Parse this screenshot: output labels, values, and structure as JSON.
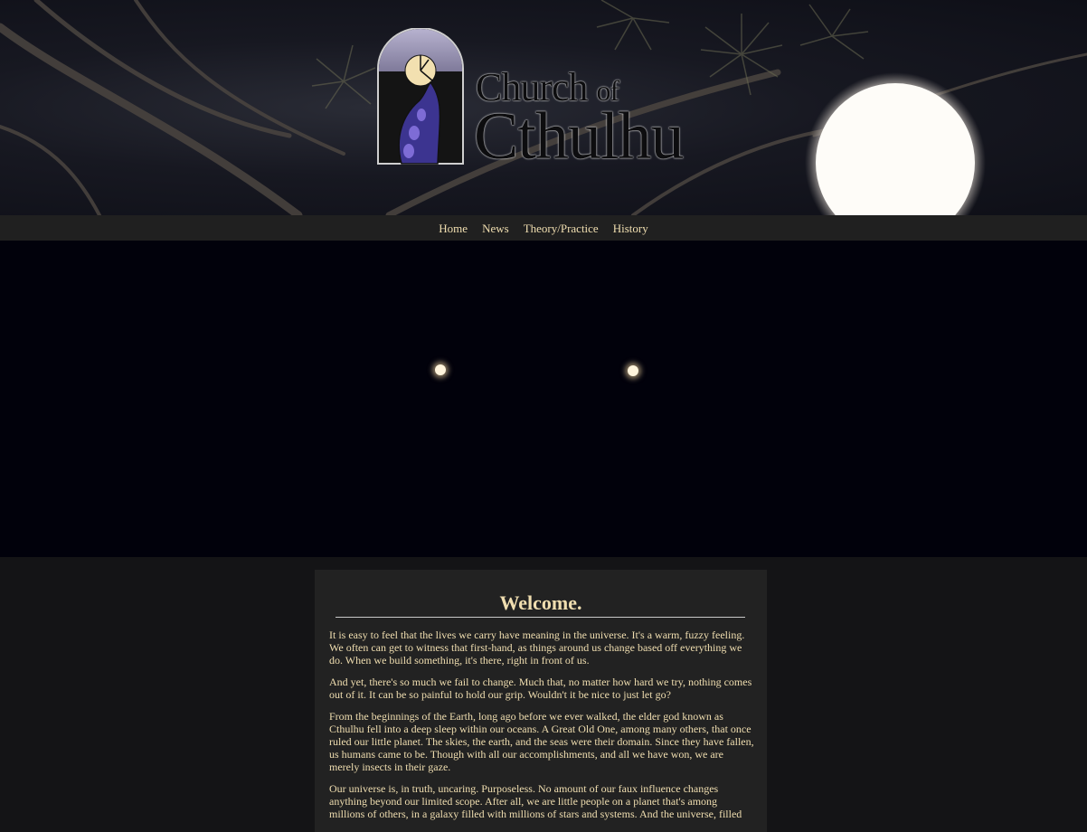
{
  "brand": {
    "line1_main": "Church",
    "line1_small": "of",
    "line2": "Cthulhu"
  },
  "nav": {
    "items": [
      {
        "label": "Home"
      },
      {
        "label": "News"
      },
      {
        "label": "Theory/Practice"
      },
      {
        "label": "History"
      }
    ]
  },
  "main": {
    "heading": "Welcome.",
    "paragraphs": [
      "It is easy to feel that the lives we carry have meaning in the universe. It's a warm, fuzzy feeling. We often can get to witness that first-hand, as things around us change based off everything we do. When we build something, it's there, right in front of us.",
      "And yet, there's so much we fail to change. Much that, no matter how hard we try, nothing comes out of it. It can be so painful to hold our grip. Wouldn't it be nice to just let go?",
      "From the beginnings of the Earth, long ago before we ever walked, the elder god known as Cthulhu fell into a deep sleep within our oceans. A Great Old One, among many others, that once ruled our little planet. The skies, the earth, and the seas were their domain. Since they have fallen, us humans came to be. Though with all our accomplishments, and all we have won, we are merely insects in their gaze.",
      "Our universe is, in truth, uncaring. Purposeless. No amount of our faux influence changes anything beyond our limited scope. After all, we are little people on a planet that's among millions of others, in a galaxy filled with millions of stars and systems. And the universe, filled"
    ]
  },
  "colors": {
    "nav_text": "#f0deb0",
    "nav_bg": "#202020",
    "hero_bg": "#01010b",
    "content_bg": "#222222",
    "page_bg": "#141416"
  },
  "icons": {
    "logo": "tentacle-moon-arch-icon"
  }
}
